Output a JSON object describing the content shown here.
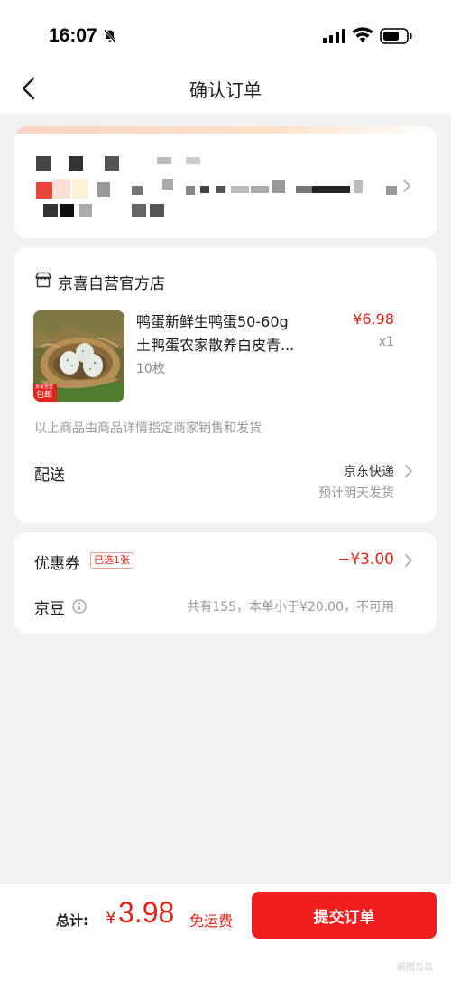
{
  "status_bar": {
    "time": "16:07",
    "icons": [
      "bell-slash-icon",
      "signal-icon",
      "wifi-icon",
      "battery-icon"
    ]
  },
  "nav": {
    "back_icon": "chevron-left-icon",
    "title": "确认订单"
  },
  "address": {
    "content_blurred": true,
    "chevron_icon": "chevron-right-icon"
  },
  "shop": {
    "icon": "store-icon",
    "name": "京喜自营官方店",
    "product": {
      "title_line1": "鸭蛋新鲜生鸭蛋50-60g",
      "title_line2": "土鸭蛋农家散养白皮青...",
      "spec": "10枚",
      "price": "¥6.98",
      "quantity": "x1",
      "image_badge_top": "京喜自营",
      "image_badge_bottom": "包邮"
    },
    "seller_note": "以上商品由商品详情指定商家销售和发货",
    "delivery": {
      "label": "配送",
      "method": "京东快递",
      "eta": "预计明天发货"
    }
  },
  "coupon": {
    "label": "优惠券",
    "badge": "已选1张",
    "amount": "−¥3.00"
  },
  "beans": {
    "label": "京豆",
    "info_icon": "info-icon",
    "note": "共有155，本单小于¥20.00，不可用"
  },
  "footer": {
    "total_label": "总计:",
    "currency": "¥",
    "total_amount": "3.98",
    "free_shipping": "免运费",
    "submit_label": "提交订单",
    "watermark": "画图岛岛"
  },
  "colors": {
    "accent_red": "#e2231a",
    "button_red": "#f01e1e",
    "background": "#f2f2f2",
    "card": "#ffffff"
  }
}
